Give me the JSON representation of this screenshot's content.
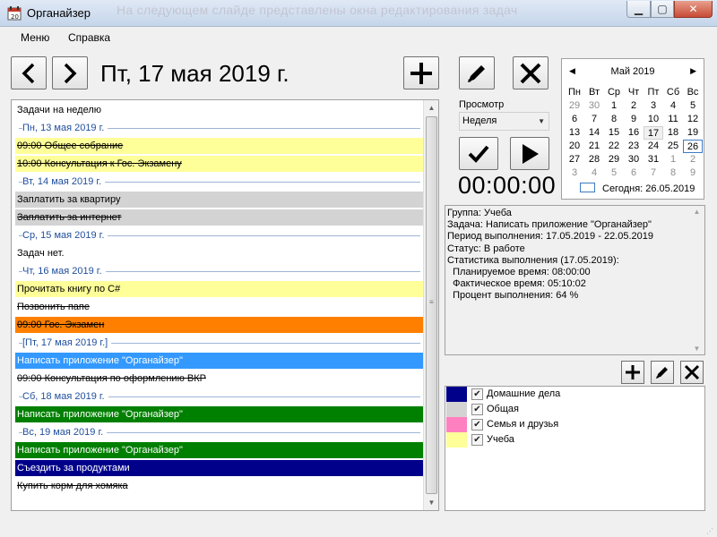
{
  "window": {
    "title": "Органайзер",
    "ghost_text": "На следующем слайде представлены окна редактирования задач"
  },
  "menu": [
    "Меню",
    "Справка"
  ],
  "header": {
    "date_title": "Пт, 17 мая 2019 г."
  },
  "task_list": {
    "rows": [
      {
        "kind": "section",
        "text": "Задачи на неделю"
      },
      {
        "kind": "day",
        "text": "Пн, 13 мая 2019 г."
      },
      {
        "kind": "task",
        "text": "09:00 Общее собрание",
        "bg": "#ffff99",
        "color": "#000000",
        "done": true
      },
      {
        "kind": "task",
        "text": "10:00 Консультация к Гос. Экзамену",
        "bg": "#ffff99",
        "color": "#000000",
        "done": true
      },
      {
        "kind": "day",
        "text": "Вт, 14 мая 2019 г."
      },
      {
        "kind": "task",
        "text": "Заплатить за квартиру",
        "bg": "#d3d3d3",
        "color": "#000000",
        "done": false
      },
      {
        "kind": "task",
        "text": "Заплатить за интернет",
        "bg": "#d3d3d3",
        "color": "#000000",
        "done": true
      },
      {
        "kind": "day",
        "text": "Ср, 15 мая 2019 г."
      },
      {
        "kind": "task",
        "text": "Задач нет.",
        "bg": "#ffffff",
        "color": "#000000",
        "done": false
      },
      {
        "kind": "day",
        "text": "Чт, 16 мая 2019 г."
      },
      {
        "kind": "task",
        "text": "Прочитать книгу по C#",
        "bg": "#ffff99",
        "color": "#000000",
        "done": false
      },
      {
        "kind": "task",
        "text": "Позвонить папе",
        "bg": "#ffffff",
        "color": "#000000",
        "done": true
      },
      {
        "kind": "task",
        "text": "09:00 Гос. Экзамен",
        "bg": "#ff8000",
        "color": "#000000",
        "done": true
      },
      {
        "kind": "day",
        "text": "[Пт, 17 мая 2019 г.]"
      },
      {
        "kind": "task",
        "text": "Написать приложение \"Органайзер\"",
        "bg": "#3399ff",
        "color": "#ffffff",
        "done": false
      },
      {
        "kind": "task",
        "text": "09:00 Консультация по оформлению ВКР",
        "bg": "#ffffff",
        "color": "#000000",
        "done": true
      },
      {
        "kind": "day",
        "text": "Сб, 18 мая 2019 г."
      },
      {
        "kind": "task",
        "text": "Написать приложение \"Органайзер\"",
        "bg": "#008000",
        "color": "#ffffff",
        "done": false
      },
      {
        "kind": "day",
        "text": "Вс, 19 мая 2019 г."
      },
      {
        "kind": "task",
        "text": "Написать приложение \"Органайзер\"",
        "bg": "#008000",
        "color": "#ffffff",
        "done": false
      },
      {
        "kind": "task",
        "text": "Съездить за продуктами",
        "bg": "#00008b",
        "color": "#ffffff",
        "done": false
      },
      {
        "kind": "task",
        "text": "Купить корм для хомяка",
        "bg": "#ffffff",
        "color": "#000000",
        "done": true
      }
    ]
  },
  "view": {
    "label": "Просмотр",
    "selected": "Неделя"
  },
  "timer": {
    "value": "00:00:00"
  },
  "calendar": {
    "month_title": "Май 2019",
    "weekdays": [
      "Пн",
      "Вт",
      "Ср",
      "Чт",
      "Пт",
      "Сб",
      "Вс"
    ],
    "days": [
      {
        "d": "29",
        "dim": true
      },
      {
        "d": "30",
        "dim": true
      },
      {
        "d": "1"
      },
      {
        "d": "2"
      },
      {
        "d": "3"
      },
      {
        "d": "4"
      },
      {
        "d": "5"
      },
      {
        "d": "6"
      },
      {
        "d": "7"
      },
      {
        "d": "8"
      },
      {
        "d": "9"
      },
      {
        "d": "10"
      },
      {
        "d": "11"
      },
      {
        "d": "12"
      },
      {
        "d": "13"
      },
      {
        "d": "14"
      },
      {
        "d": "15"
      },
      {
        "d": "16"
      },
      {
        "d": "17",
        "selected": true
      },
      {
        "d": "18"
      },
      {
        "d": "19"
      },
      {
        "d": "20"
      },
      {
        "d": "21"
      },
      {
        "d": "22"
      },
      {
        "d": "23"
      },
      {
        "d": "24"
      },
      {
        "d": "25"
      },
      {
        "d": "26",
        "today": true
      },
      {
        "d": "27"
      },
      {
        "d": "28"
      },
      {
        "d": "29"
      },
      {
        "d": "30"
      },
      {
        "d": "31"
      },
      {
        "d": "1",
        "dim": true
      },
      {
        "d": "2",
        "dim": true
      },
      {
        "d": "3",
        "dim": true
      },
      {
        "d": "4",
        "dim": true
      },
      {
        "d": "5",
        "dim": true
      },
      {
        "d": "6",
        "dim": true
      },
      {
        "d": "7",
        "dim": true
      },
      {
        "d": "8",
        "dim": true
      },
      {
        "d": "9",
        "dim": true
      }
    ],
    "today_label": "Сегодня: 26.05.2019"
  },
  "info": {
    "lines": [
      "Группа: Учеба",
      "Задача: Написать приложение \"Органайзер\"",
      "Период выполнения: 17.05.2019 - 22.05.2019",
      "Статус: В работе",
      "Статистика выполнения (17.05.2019):",
      "  Планируемое время: 08:00:00",
      "  Фактическое время: 05:10:02",
      "  Процент выполнения: 64 %"
    ]
  },
  "groups": [
    {
      "name": "Домашние дела",
      "color": "#00008b",
      "checked": true
    },
    {
      "name": "Общая",
      "color": "#d3d3d3",
      "checked": true
    },
    {
      "name": "Семья и друзья",
      "color": "#ff80c0",
      "checked": true
    },
    {
      "name": "Учеба",
      "color": "#ffff99",
      "checked": true
    }
  ]
}
